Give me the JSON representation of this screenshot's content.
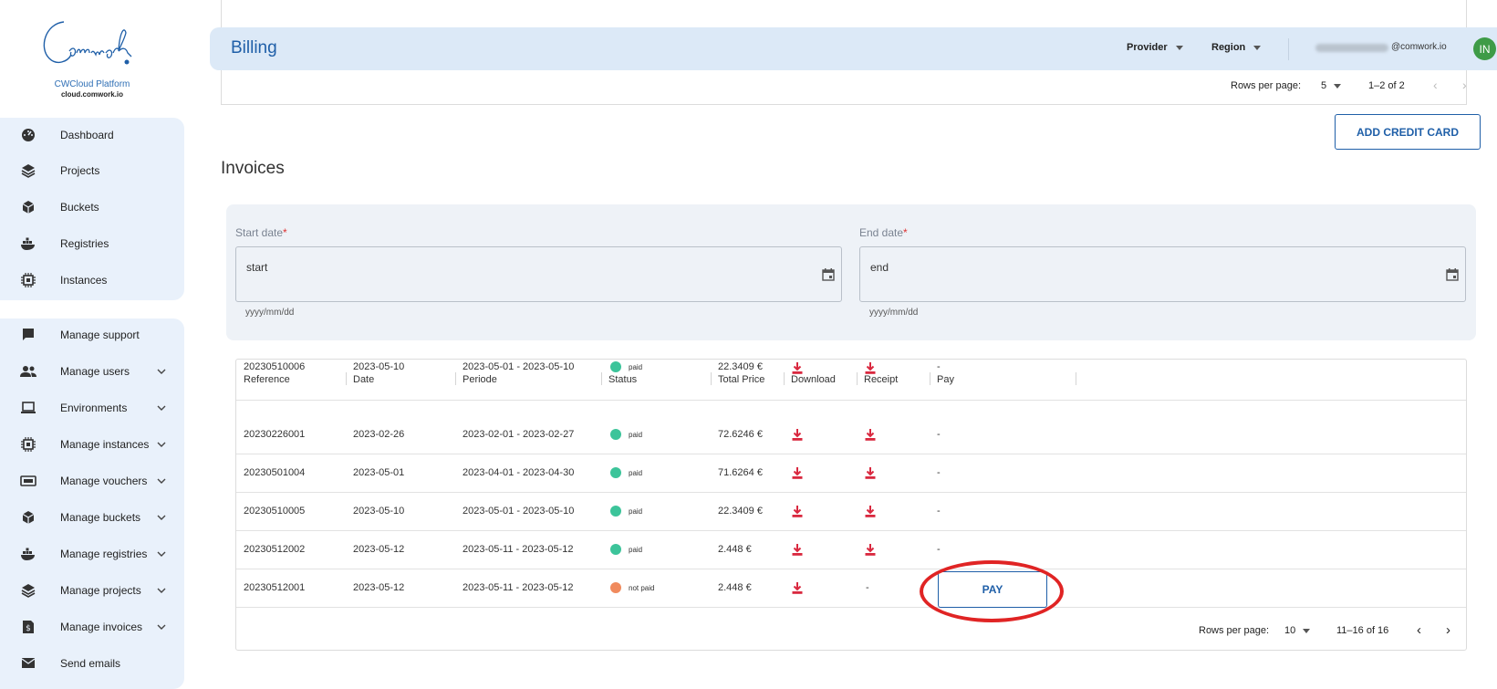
{
  "brand": {
    "logo_alt": "Comwork",
    "platform": "CWCloud Platform",
    "domain": "cloud.comwork.io"
  },
  "sidebar": {
    "main_items": [
      {
        "label": "Dashboard",
        "icon": "dashboard-icon"
      },
      {
        "label": "Projects",
        "icon": "layers-icon"
      },
      {
        "label": "Buckets",
        "icon": "cube-icon"
      },
      {
        "label": "Registries",
        "icon": "docker-icon"
      },
      {
        "label": "Instances",
        "icon": "chip-icon"
      }
    ],
    "admin_items": [
      {
        "label": "Manage support",
        "icon": "chat-icon"
      },
      {
        "label": "Manage users",
        "icon": "users-icon"
      },
      {
        "label": "Environments",
        "icon": "laptop-icon"
      },
      {
        "label": "Manage instances",
        "icon": "chip-icon"
      },
      {
        "label": "Manage vouchers",
        "icon": "voucher-icon"
      },
      {
        "label": "Manage buckets",
        "icon": "cube-icon"
      },
      {
        "label": "Manage registries",
        "icon": "docker-icon"
      },
      {
        "label": "Manage projects",
        "icon": "layers-icon"
      },
      {
        "label": "Manage invoices",
        "icon": "invoice-icon"
      },
      {
        "label": "Send emails",
        "icon": "mail-icon"
      }
    ]
  },
  "topbar": {
    "title": "Billing",
    "provider_label": "Provider",
    "region_label": "Region",
    "email_domain": "@comwork.io",
    "avatar_initials": "IN",
    "avatar_color": "#3e9b47"
  },
  "cards_table": {
    "rows_per_page_label": "Rows per page:",
    "rows_per_page": "5",
    "range": "1–2 of 2"
  },
  "add_credit_card_label": "ADD CREDIT CARD",
  "invoices": {
    "heading": "Invoices",
    "start_label": "Start date",
    "end_label": "End date",
    "required_mark": "*",
    "start_value": "start",
    "end_value": "end",
    "date_hint": "yyyy/mm/dd",
    "columns": [
      "Reference",
      "Date",
      "Periode",
      "Status",
      "Total Price",
      "Download",
      "Receipt",
      "Pay"
    ],
    "rows": [
      {
        "ref": "20230510006",
        "date": "2023-05-10",
        "period": "2023-05-01 - 2023-05-10",
        "status": "paid",
        "price": "22.3409 €",
        "receipt": true,
        "pay": "-"
      },
      {
        "ref": "20230226001",
        "date": "2023-02-26",
        "period": "2023-02-01 - 2023-02-27",
        "status": "paid",
        "price": "72.6246 €",
        "receipt": true,
        "pay": "-"
      },
      {
        "ref": "20230501004",
        "date": "2023-05-01",
        "period": "2023-04-01 - 2023-04-30",
        "status": "paid",
        "price": "71.6264 €",
        "receipt": true,
        "pay": "-"
      },
      {
        "ref": "20230510005",
        "date": "2023-05-10",
        "period": "2023-05-01 - 2023-05-10",
        "status": "paid",
        "price": "22.3409 €",
        "receipt": true,
        "pay": "-"
      },
      {
        "ref": "20230512002",
        "date": "2023-05-12",
        "period": "2023-05-11 - 2023-05-12",
        "status": "paid",
        "price": "2.448 €",
        "receipt": true,
        "pay": "-"
      },
      {
        "ref": "20230512001",
        "date": "2023-05-12",
        "period": "2023-05-11 - 2023-05-12",
        "status": "not paid",
        "price": "2.448 €",
        "receipt": false,
        "receipt_text": "-",
        "pay": "PAY"
      }
    ],
    "status_colors": {
      "paid": "#3cc49a",
      "not paid": "#f08a5d"
    },
    "download_color": "#d9283f",
    "pager": {
      "rows_per_page_label": "Rows per page:",
      "rows_per_page": "10",
      "range": "11–16 of 16"
    }
  },
  "highlight_color": "#e02424"
}
